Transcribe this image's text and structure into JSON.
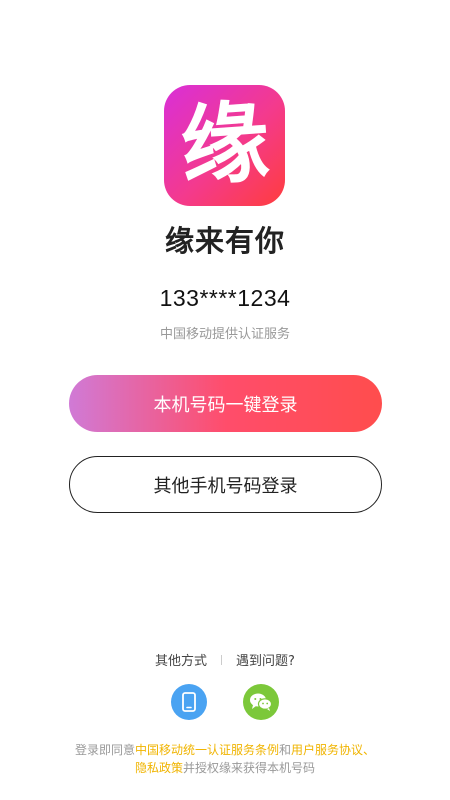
{
  "app": {
    "logo_glyph": "缘",
    "name": "缘来有你"
  },
  "login": {
    "masked_phone": "133****1234",
    "provider_text": "中国移动提供认证服务",
    "one_click_label": "本机号码一键登录",
    "other_phone_label": "其他手机号码登录"
  },
  "alt": {
    "other_methods_label": "其他方式",
    "help_label": "遇到问题?",
    "icons": [
      "phone-icon",
      "wechat-icon"
    ]
  },
  "agreement": {
    "prefix": "登录即同意",
    "link_cmcc": "中国移动统一认证服务条例",
    "conj": "和",
    "link_user": "用户服务协议、",
    "link_privacy": "隐私政策",
    "suffix": "并授权缘来获得本机号码"
  },
  "colors": {
    "brand_gradient": [
      "#d92fd8",
      "#ff3d3d"
    ],
    "phone_icon_bg": "#4aa3f2",
    "wechat_icon_bg": "#7cc83a",
    "link": "#f0b400"
  }
}
